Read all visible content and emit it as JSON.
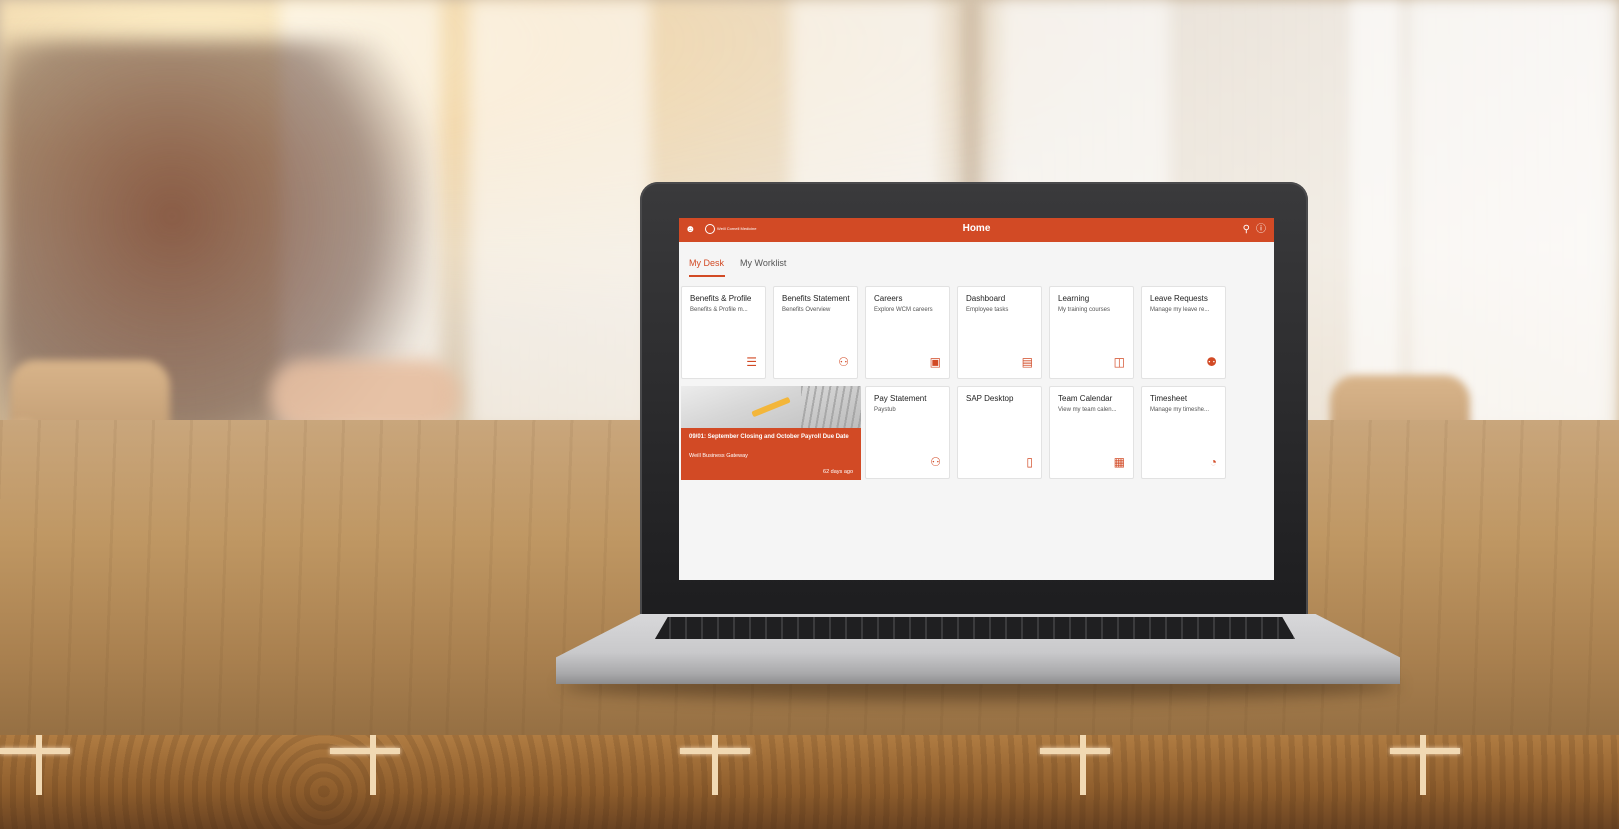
{
  "colors": {
    "accent": "#d24a25",
    "screen_bg": "#f5f5f5"
  },
  "app": {
    "title": "Home",
    "logo_text": "Weill Cornell Medicine",
    "icons": {
      "user": "user-icon",
      "search": "search-icon",
      "help": "help-icon"
    }
  },
  "tabs": [
    {
      "label": "My Desk",
      "active": true
    },
    {
      "label": "My Worklist",
      "active": false
    }
  ],
  "tiles_row1": [
    {
      "title": "Benefits & Profile",
      "subtitle": "Benefits & Profile m...",
      "icon": "list-icon",
      "glyph": "☰"
    },
    {
      "title": "Benefits Statement",
      "subtitle": "Benefits Overview",
      "icon": "family-icon",
      "glyph": "⚇"
    },
    {
      "title": "Careers",
      "subtitle": "Explore WCM careers",
      "icon": "briefcase-icon",
      "glyph": "▣"
    },
    {
      "title": "Dashboard",
      "subtitle": "Employee tasks",
      "icon": "dashboard-icon",
      "glyph": "▤"
    },
    {
      "title": "Learning",
      "subtitle": "My training courses",
      "icon": "learning-icon",
      "glyph": "◫"
    },
    {
      "title": "Leave Requests",
      "subtitle": "Manage my leave re...",
      "icon": "leave-request-icon",
      "glyph": "⚉"
    }
  ],
  "news": {
    "title": "09/01: September Closing and October Payroll Due Date",
    "source": "Weill Business Gateway",
    "age": "62 days ago"
  },
  "tiles_row2": [
    {
      "title": "Pay Statement",
      "subtitle": "Paystub",
      "icon": "pay-statement-icon",
      "glyph": "⚇"
    },
    {
      "title": "SAP Desktop",
      "subtitle": "",
      "icon": "document-icon",
      "glyph": "▯"
    },
    {
      "title": "Team Calendar",
      "subtitle": "View my team calen...",
      "icon": "team-calendar-icon",
      "glyph": "▦"
    },
    {
      "title": "Timesheet",
      "subtitle": "Manage my timeshe...",
      "icon": "timesheet-icon",
      "glyph": "◔"
    }
  ]
}
